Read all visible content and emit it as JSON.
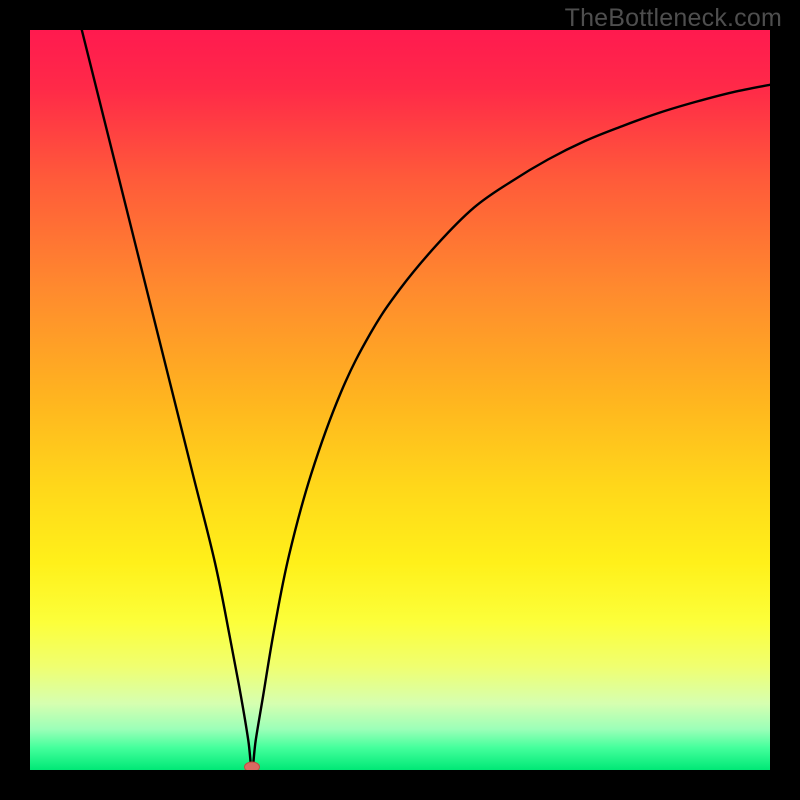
{
  "watermark": "TheBottleneck.com",
  "colors": {
    "frame": "#000000",
    "gradient_stops": [
      {
        "offset": 0.0,
        "color": "#ff1a4f"
      },
      {
        "offset": 0.08,
        "color": "#ff2a48"
      },
      {
        "offset": 0.2,
        "color": "#ff5a3a"
      },
      {
        "offset": 0.35,
        "color": "#ff8a2e"
      },
      {
        "offset": 0.5,
        "color": "#ffb51f"
      },
      {
        "offset": 0.62,
        "color": "#ffd81a"
      },
      {
        "offset": 0.72,
        "color": "#fff01a"
      },
      {
        "offset": 0.8,
        "color": "#fcff3a"
      },
      {
        "offset": 0.86,
        "color": "#f0ff70"
      },
      {
        "offset": 0.91,
        "color": "#d6ffb0"
      },
      {
        "offset": 0.945,
        "color": "#9bffb8"
      },
      {
        "offset": 0.97,
        "color": "#44ff9c"
      },
      {
        "offset": 1.0,
        "color": "#00e876"
      }
    ],
    "curve": "#000000",
    "marker_fill": "#d96a62",
    "marker_stroke": "#c44b42"
  },
  "chart_data": {
    "type": "line",
    "title": "",
    "xlabel": "",
    "ylabel": "",
    "xlim": [
      0,
      100
    ],
    "ylim": [
      0,
      100
    ],
    "grid": false,
    "legend": false,
    "marker": {
      "x": 30,
      "y": 0
    },
    "series": [
      {
        "name": "bottleneck-curve",
        "x": [
          7,
          10,
          13,
          16,
          19,
          22,
          25,
          27,
          28.5,
          29.5,
          30,
          30.5,
          31.5,
          33,
          35,
          38,
          42,
          46,
          50,
          55,
          60,
          65,
          70,
          75,
          80,
          85,
          90,
          95,
          100
        ],
        "y": [
          100,
          88,
          76,
          64,
          52,
          40,
          28,
          18,
          10,
          4,
          0,
          4,
          10,
          19,
          29,
          40,
          51,
          59,
          65,
          71,
          76,
          79.5,
          82.5,
          85,
          87,
          88.8,
          90.3,
          91.6,
          92.6
        ]
      }
    ]
  }
}
